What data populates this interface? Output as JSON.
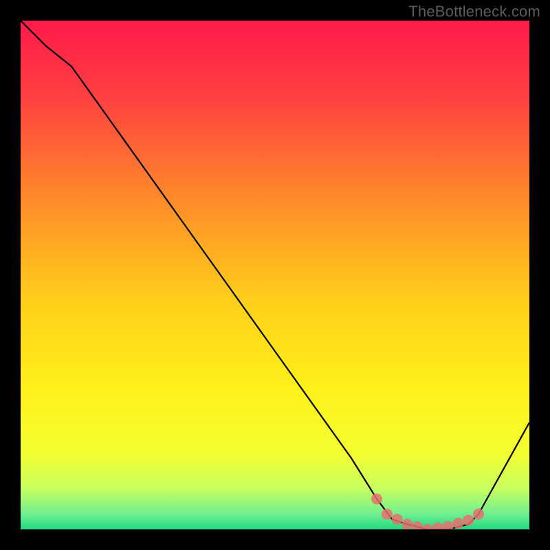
{
  "attribution": "TheBottleneck.com",
  "chart_data": {
    "type": "line",
    "title": "",
    "xlabel": "",
    "ylabel": "",
    "xlim": [
      0,
      100
    ],
    "ylim": [
      0,
      100
    ],
    "series": [
      {
        "name": "bottleneck-curve",
        "x": [
          0,
          5,
          10,
          15,
          20,
          25,
          30,
          35,
          40,
          45,
          50,
          55,
          60,
          65,
          70,
          73,
          76,
          80,
          84,
          88,
          90,
          95,
          100
        ],
        "values": [
          100,
          95,
          91,
          84,
          77,
          70,
          63,
          56,
          49,
          42,
          35,
          28,
          21,
          14,
          6,
          2,
          1,
          0,
          0,
          1,
          3,
          12,
          21
        ]
      }
    ],
    "markers": {
      "name": "highlight-points",
      "x": [
        70,
        72,
        74,
        76,
        78,
        80,
        82,
        84,
        86,
        88,
        90
      ],
      "values": [
        6,
        3,
        2,
        1,
        0.5,
        0,
        0.3,
        0.6,
        1.2,
        1.8,
        3
      ]
    },
    "gradient_stops": [
      {
        "offset": 0.0,
        "color": "#ff1a4b"
      },
      {
        "offset": 0.15,
        "color": "#ff4040"
      },
      {
        "offset": 0.35,
        "color": "#ff8a2a"
      },
      {
        "offset": 0.55,
        "color": "#ffcf1a"
      },
      {
        "offset": 0.72,
        "color": "#fff01a"
      },
      {
        "offset": 0.85,
        "color": "#f4ff30"
      },
      {
        "offset": 0.92,
        "color": "#c8ff60"
      },
      {
        "offset": 0.97,
        "color": "#70f090"
      },
      {
        "offset": 1.0,
        "color": "#20d880"
      }
    ]
  }
}
